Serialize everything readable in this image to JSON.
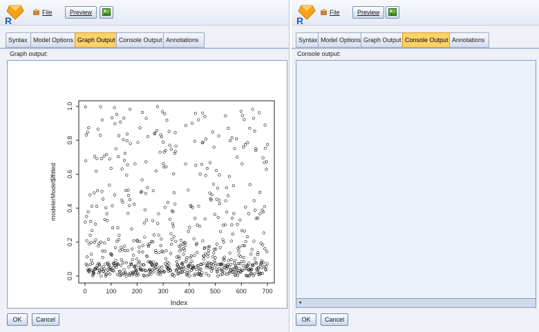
{
  "left_window": {
    "toolbar": {
      "file_label": "File",
      "preview_label": "Preview",
      "image_icon": "image-icon"
    },
    "tabs": [
      {
        "label": "Syntax"
      },
      {
        "label": "Model Options"
      },
      {
        "label": "Graph Output"
      },
      {
        "label": "Console Output"
      },
      {
        "label": "Annotations"
      }
    ],
    "active_tab": "Graph Output",
    "section_label": "Graph output:",
    "buttons": {
      "ok": "OK",
      "cancel": "Cancel"
    }
  },
  "right_window": {
    "toolbar": {
      "file_label": "File",
      "preview_label": "Preview",
      "image_icon": "image-icon"
    },
    "tabs": [
      {
        "label": "Syntax"
      },
      {
        "label": "Model Options"
      },
      {
        "label": "Graph Output"
      },
      {
        "label": "Console Output"
      },
      {
        "label": "Annotations"
      }
    ],
    "active_tab": "Console Output",
    "section_label": "Console output:",
    "buttons": {
      "ok": "OK",
      "cancel": "Cancel"
    }
  },
  "chart_data": {
    "type": "scatter",
    "xlabel": "Index",
    "ylabel": "modelerModel$ffitted",
    "xlim": [
      0,
      700
    ],
    "ylim": [
      0,
      1
    ],
    "xticks": [
      0,
      100,
      200,
      300,
      400,
      500,
      600,
      700
    ],
    "yticks": [
      0.0,
      0.2,
      0.4,
      0.6,
      0.8,
      1.0
    ],
    "n_points": 700,
    "marker": "open-circle",
    "distribution_note": "dense band near 0.0-0.1, sparser up to 1.0"
  },
  "colors": {
    "active_tab": "#fbd26a",
    "r_logo_orange": "#f7a21b",
    "r_logo_blue": "#1f5fa8"
  }
}
